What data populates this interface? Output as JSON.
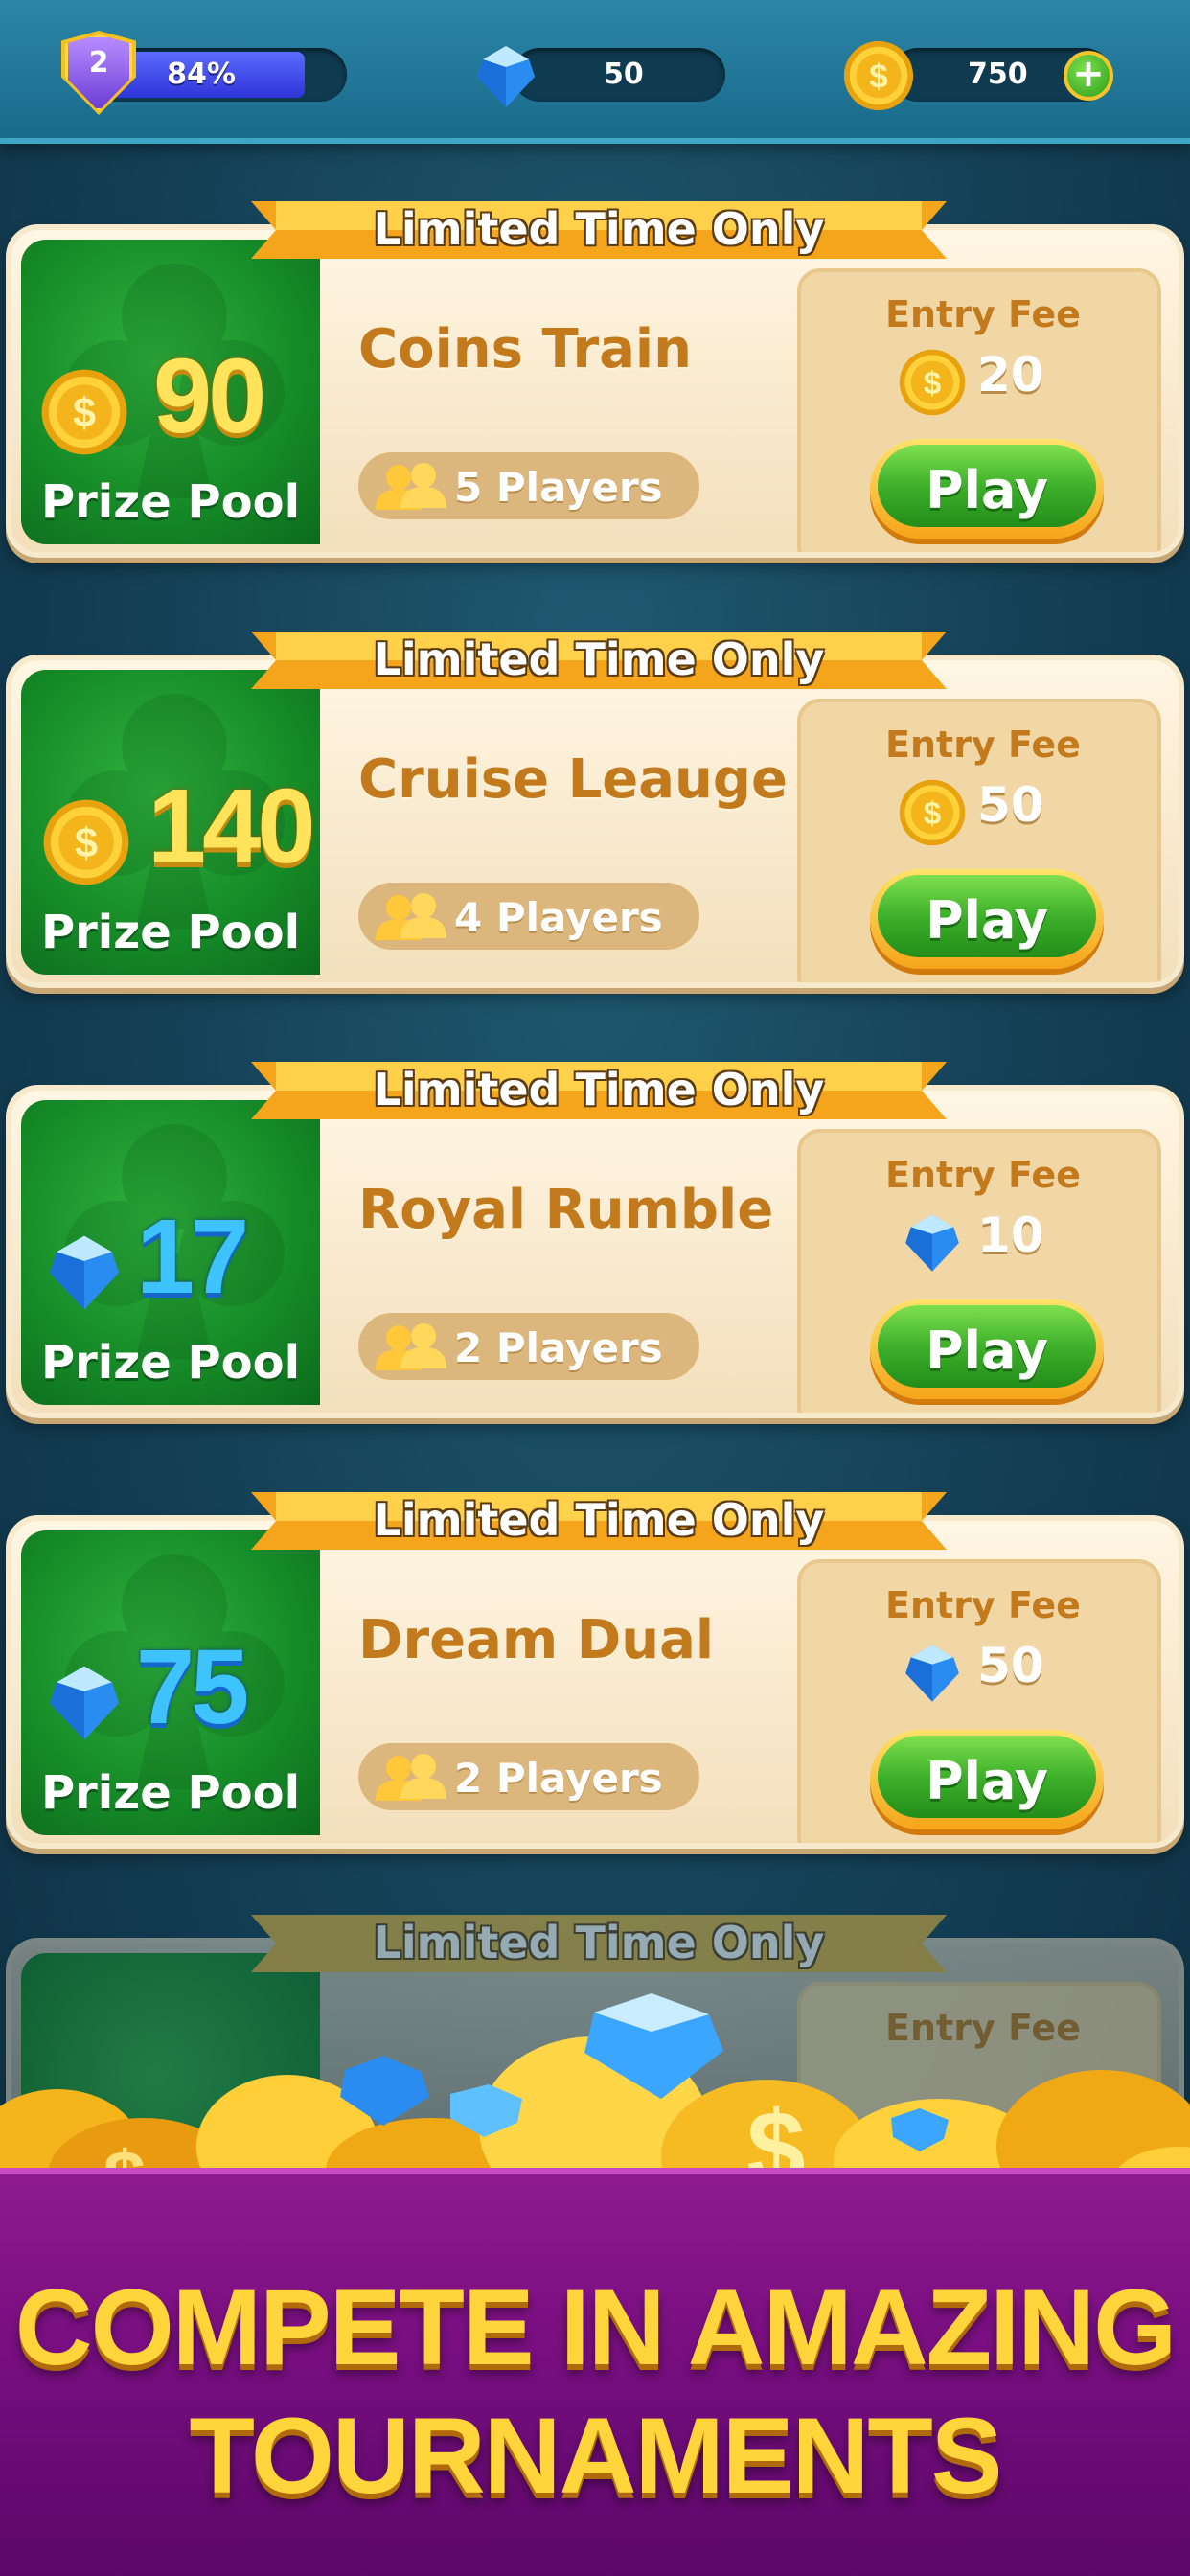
{
  "hud": {
    "level": "2",
    "level_progress": 0.84,
    "level_percent_label": "84%",
    "gems": "50",
    "coins": "750",
    "add_coins_symbol": "+"
  },
  "ribbon_text": "Limited Time Only",
  "prize_label": "Prize Pool",
  "entry_fee_label": "Entry Fee",
  "play_label": "Play",
  "tournaments": [
    {
      "name": "Coins Train",
      "prize": "90",
      "prize_currency": "coin",
      "players": "5 Players",
      "fee": "20",
      "fee_currency": "coin"
    },
    {
      "name": "Cruise Leauge",
      "prize": "140",
      "prize_currency": "coin",
      "players": "4 Players",
      "fee": "50",
      "fee_currency": "coin"
    },
    {
      "name": "Royal Rumble",
      "prize": "17",
      "prize_currency": "gem",
      "players": "2 Players",
      "fee": "10",
      "fee_currency": "gem"
    },
    {
      "name": "Dream Dual",
      "prize": "75",
      "prize_currency": "gem",
      "players": "2 Players",
      "fee": "50",
      "fee_currency": "gem"
    }
  ],
  "partial_card": {
    "ribbon_text": "Limited Time Only",
    "entry_fee_label": "Entry Fee"
  },
  "banner": {
    "line1": "COMPETE IN AMAZING",
    "line2": "TOURNAMENTS"
  },
  "colors": {
    "coin": "#f6c21f",
    "gem": "#3aa6ff",
    "play_green": "#3eb02a",
    "card_bg": "#fbecd2",
    "banner_purple": "#7a0f82"
  }
}
